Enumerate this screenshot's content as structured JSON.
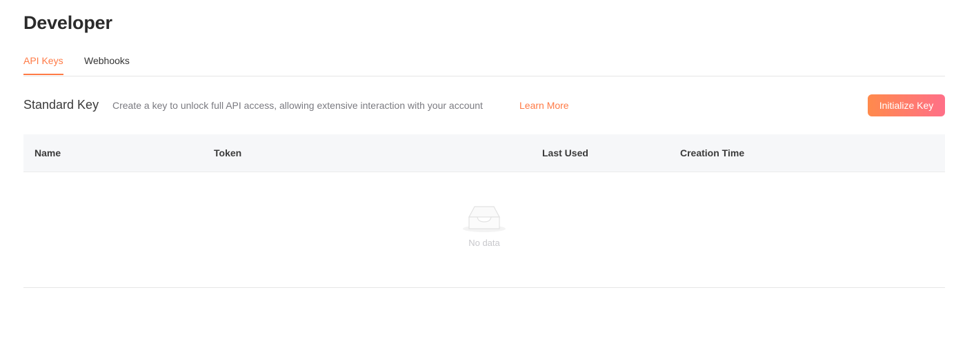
{
  "page": {
    "title": "Developer"
  },
  "tabs": [
    {
      "label": "API Keys",
      "active": true
    },
    {
      "label": "Webhooks",
      "active": false
    }
  ],
  "standard_key": {
    "title": "Standard Key",
    "description": "Create a key to unlock full API access, allowing extensive interaction with your account",
    "learn_more": "Learn More",
    "button_label": "Initialize Key"
  },
  "table": {
    "columns": [
      "Name",
      "Token",
      "Last Used",
      "Creation Time"
    ],
    "rows": [],
    "empty_text": "No data",
    "empty_icon": "inbox-icon"
  },
  "colors": {
    "accent": "#ff7a45",
    "button_gradient_start": "#ff8a4c",
    "button_gradient_end": "#ff6f88",
    "header_bg": "#f6f7f9"
  }
}
